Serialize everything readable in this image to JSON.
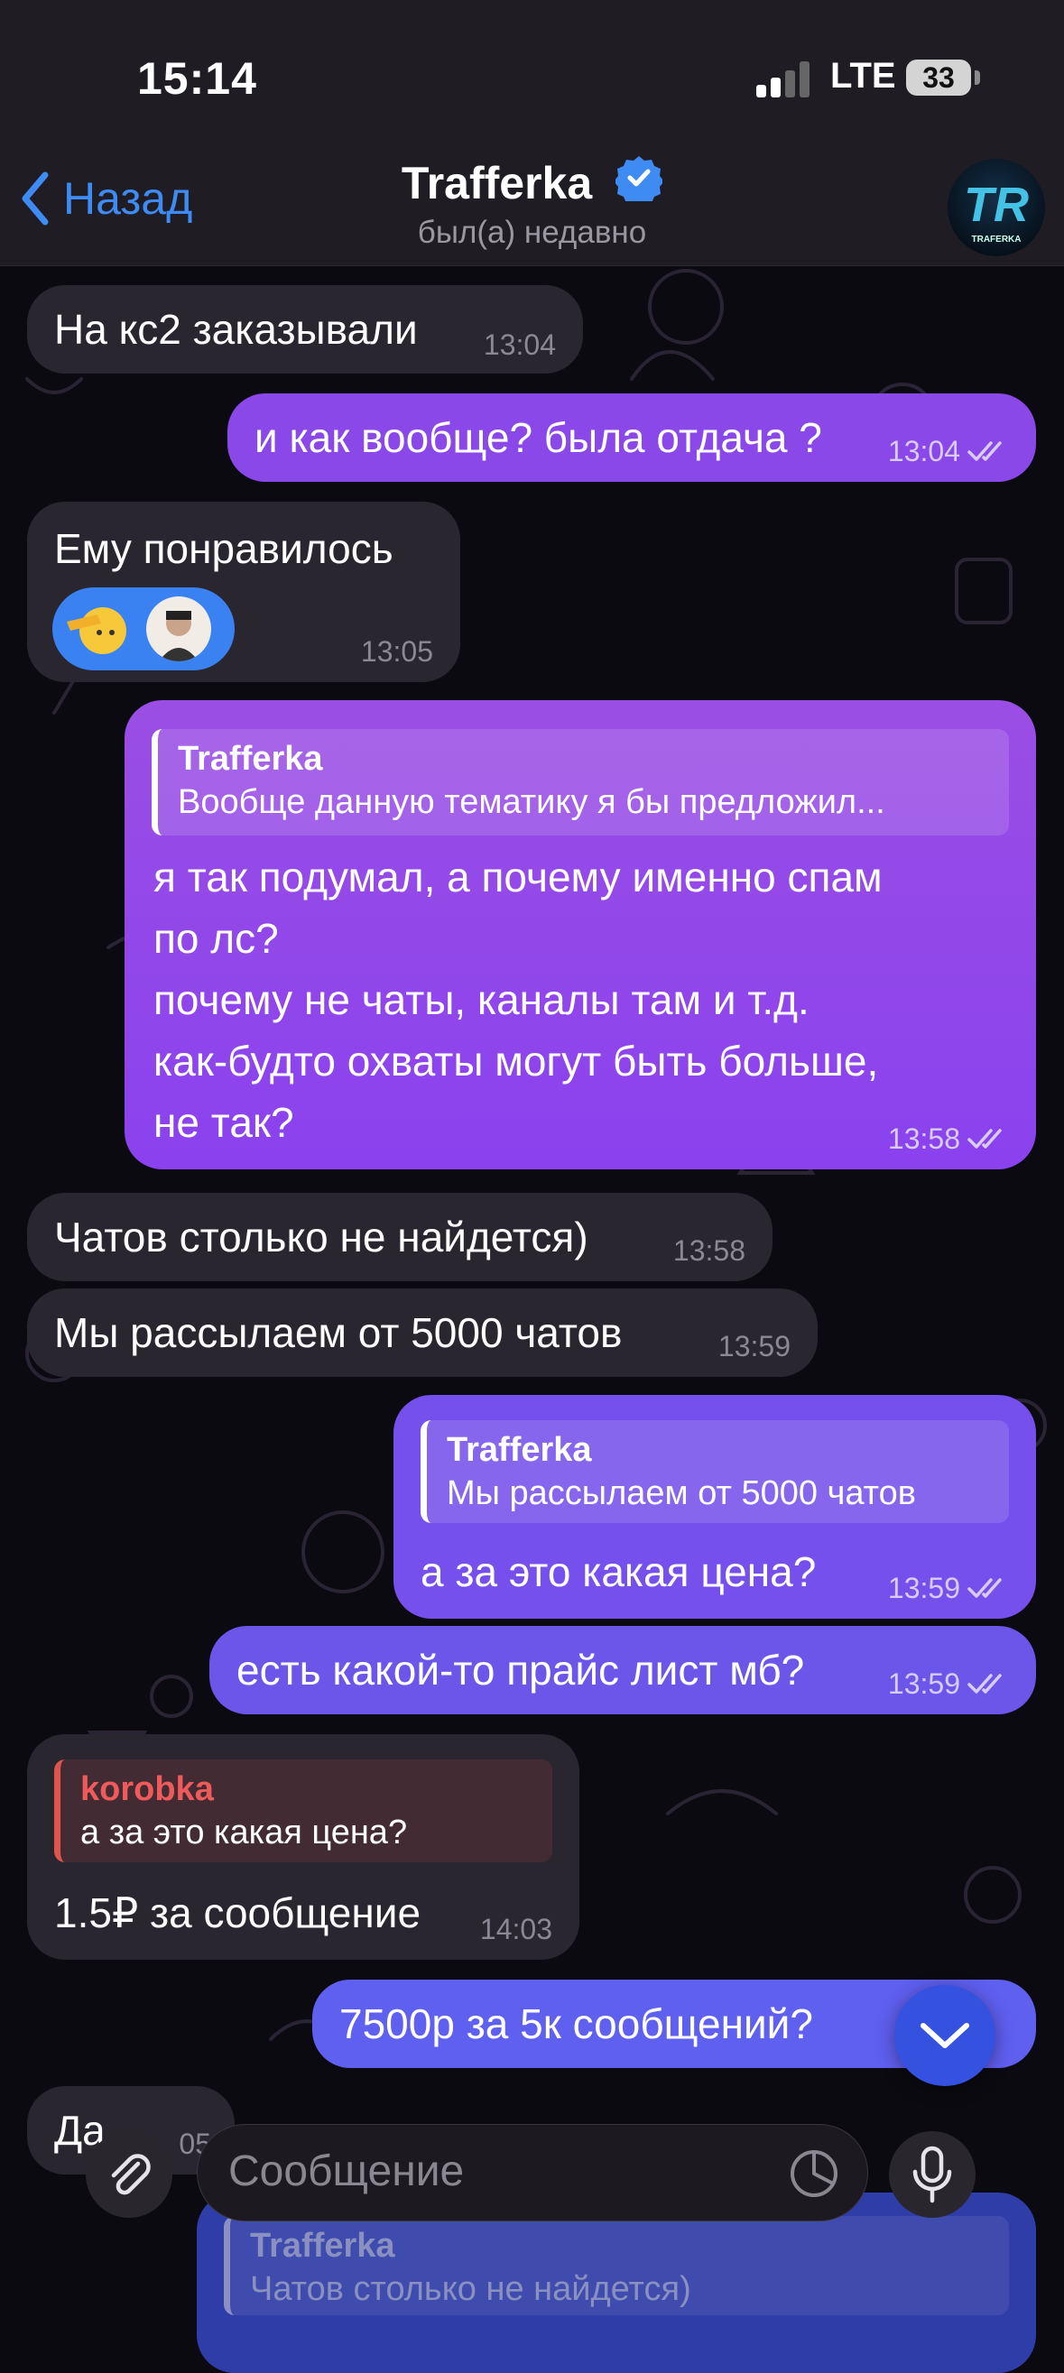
{
  "status_bar": {
    "time": "15:14",
    "network": "LTE",
    "battery": "33"
  },
  "header": {
    "back_label": "Назад",
    "chat_name": "Trafferka",
    "status": "был(а) недавно",
    "avatar_text": "TR",
    "avatar_subtext": "TRAFERKA"
  },
  "messages": [
    {
      "dir": "in",
      "text": "На кс2 заказывали",
      "time": "13:04"
    },
    {
      "dir": "out",
      "text": "и как вообще? была отдача ?",
      "time": "13:04"
    },
    {
      "dir": "in",
      "text": "Ему понравилось",
      "time": "13:05",
      "reaction": "emoji-reaction"
    },
    {
      "dir": "out",
      "reply_name": "Trafferka",
      "reply_text": "Вообще данную тематику я бы предложил...",
      "lines": [
        "я так подумал, а почему именно спам",
        "по лс?",
        "почему не чаты, каналы там и т.д.",
        "как-будто охваты могут быть больше,",
        "не так?"
      ],
      "time": "13:58"
    },
    {
      "dir": "in",
      "text": "Чатов столько не найдется)",
      "time": "13:58"
    },
    {
      "dir": "in",
      "text": "Мы рассылаем от 5000 чатов",
      "time": "13:59"
    },
    {
      "dir": "out",
      "reply_name": "Trafferka",
      "reply_text": "Мы рассылаем от 5000 чатов",
      "text": "а за это какая цена?",
      "time": "13:59"
    },
    {
      "dir": "out",
      "text": "есть какой-то прайс лист мб?",
      "time": "13:59"
    },
    {
      "dir": "in",
      "reply_name": "korobka",
      "reply_text": "а за это какая цена?",
      "text": "1.5₽ за сообщение",
      "time": "14:03"
    },
    {
      "dir": "out",
      "text": "7500р за 5к сообщений?"
    },
    {
      "dir": "in",
      "text": "Да",
      "time": "05"
    },
    {
      "dir": "out",
      "reply_name": "Trafferka",
      "reply_text": "Чатов столько не найдется)"
    }
  ],
  "input": {
    "placeholder": "Сообщение"
  },
  "colors": {
    "incoming": "#2a2630",
    "outgoing_top": "#8a48e8",
    "outgoing_bottom": "#6c56ea",
    "accent": "#3e8bf3"
  }
}
